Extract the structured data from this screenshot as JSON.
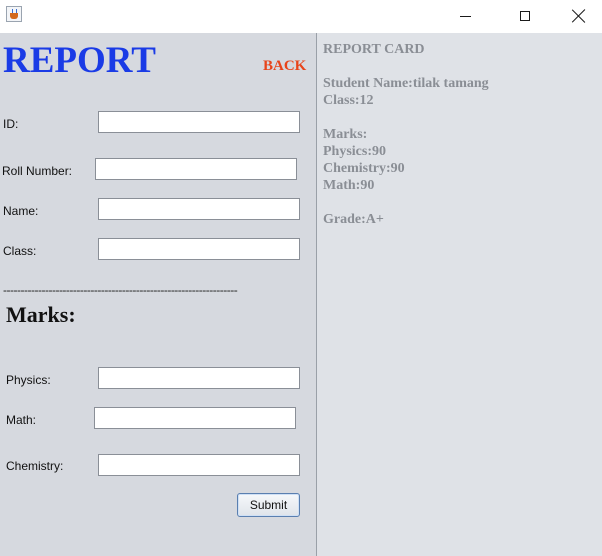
{
  "window": {
    "app_icon": "java-icon",
    "minimize_icon": "minimize-icon",
    "maximize_icon": "maximize-icon",
    "close_icon": "close-icon"
  },
  "form": {
    "title": "REPORT",
    "back_label": "BACK",
    "fields": {
      "id_label": "ID:",
      "id_value": "",
      "roll_label": "Roll Number:",
      "roll_value": "",
      "name_label": "Name:",
      "name_value": "",
      "class_label": "Class:",
      "class_value": ""
    },
    "divider": "-------------------------------------------------------------------",
    "marks_heading": "Marks:",
    "marks": {
      "physics_label": "Physics:",
      "physics_value": "",
      "math_label": "Math:",
      "math_value": "",
      "chemistry_label": "Chemistry:",
      "chemistry_value": ""
    },
    "submit_label": "Submit"
  },
  "report_card": {
    "heading": "REPORT CARD",
    "student_name": "Student Name:tilak tamang",
    "class": "Class:12",
    "marks_label": "Marks:",
    "physics": "Physics:90",
    "chemistry": "Chemistry:90",
    "math": "Math:90",
    "grade": "Grade:A+"
  },
  "colors": {
    "title": "#1a3be6",
    "back": "#e8441a",
    "card_text": "#8a8e95"
  }
}
